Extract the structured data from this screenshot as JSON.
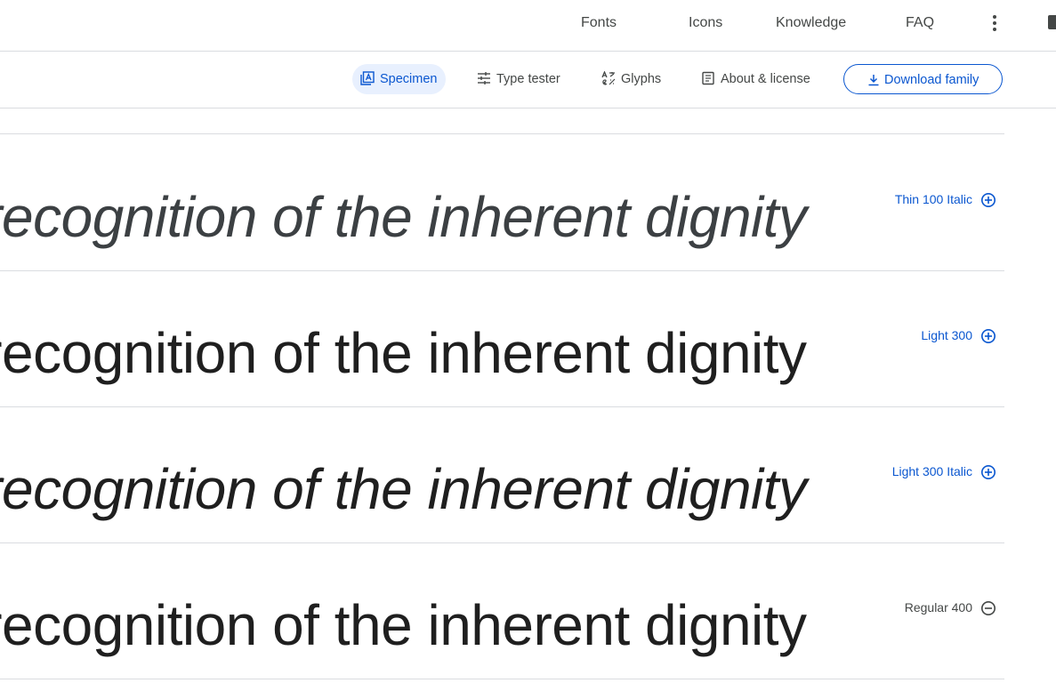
{
  "topnav": {
    "items": [
      "Fonts",
      "Icons",
      "Knowledge",
      "FAQ"
    ],
    "more_icon": "more-vert-icon"
  },
  "subnav": {
    "tabs": [
      {
        "label": "Specimen",
        "icon": "specimen-icon",
        "active": true
      },
      {
        "label": "Type tester",
        "icon": "tune-icon",
        "active": false
      },
      {
        "label": "Glyphs",
        "icon": "glyphs-icon",
        "active": false
      },
      {
        "label": "About & license",
        "icon": "article-icon",
        "active": false
      }
    ],
    "download_label": "Download family",
    "download_icon": "download-icon"
  },
  "sample_text": "Whereas recognition of the inherent dignity",
  "styles": [
    {
      "label": "Thin 100 Italic",
      "weight": 100,
      "italic": true,
      "selected": false
    },
    {
      "label": "Light 300",
      "weight": 300,
      "italic": false,
      "selected": false
    },
    {
      "label": "Light 300 Italic",
      "weight": 300,
      "italic": true,
      "selected": false
    },
    {
      "label": "Regular 400",
      "weight": 400,
      "italic": false,
      "selected": true
    }
  ],
  "colors": {
    "accent": "#0b57d0",
    "active_tab_bg": "#e8f0fe",
    "text": "#1f1f1f",
    "muted": "#444746",
    "divider": "#dadce0"
  }
}
